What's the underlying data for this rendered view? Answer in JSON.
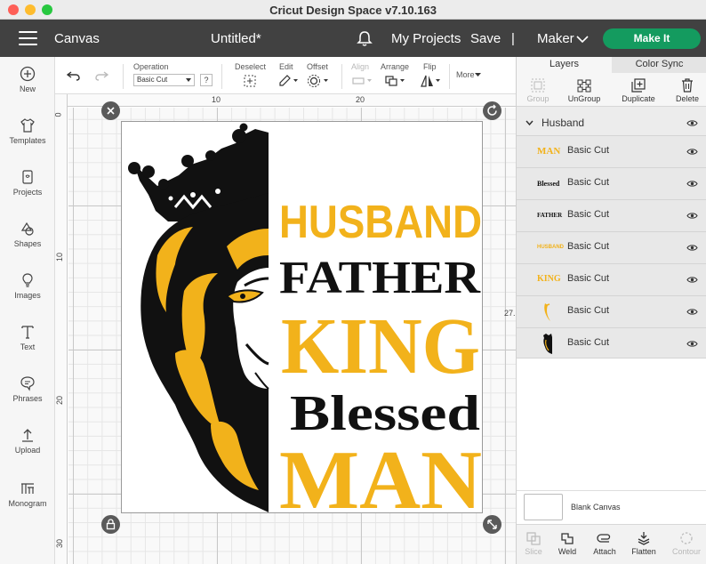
{
  "window": {
    "title": "Cricut Design Space  v7.10.163"
  },
  "header": {
    "section": "Canvas",
    "doc_title": "Untitled*",
    "my_projects": "My Projects",
    "save": "Save",
    "separator": "|",
    "machine": "Maker",
    "make_it": "Make It"
  },
  "leftnav": [
    {
      "label": "New",
      "icon": "plus-circle-icon"
    },
    {
      "label": "Templates",
      "icon": "tshirt-icon"
    },
    {
      "label": "Projects",
      "icon": "projects-icon"
    },
    {
      "label": "Shapes",
      "icon": "shapes-icon"
    },
    {
      "label": "Images",
      "icon": "lightbulb-icon"
    },
    {
      "label": "Text",
      "icon": "text-icon"
    },
    {
      "label": "Phrases",
      "icon": "speech-bubble-icon"
    },
    {
      "label": "Upload",
      "icon": "upload-icon"
    },
    {
      "label": "Monogram",
      "icon": "monogram-icon"
    }
  ],
  "toolbar": {
    "operation_label": "Operation",
    "operation_value": "Basic Cut",
    "help": "?",
    "deselect": "Deselect",
    "edit": "Edit",
    "offset": "Offset",
    "align": "Align",
    "arrange": "Arrange",
    "flip": "Flip",
    "more": "More"
  },
  "rulers": {
    "top": [
      "0",
      "10",
      "20"
    ],
    "left": [
      "0",
      "10",
      "20",
      "30"
    ],
    "height_readout": "27."
  },
  "design": {
    "words": [
      "HUSBAND",
      "FATHER",
      "KING",
      "Blessed",
      "MAN"
    ],
    "colors": {
      "gold": "#f2b21b",
      "black": "#111111"
    }
  },
  "panel": {
    "tabs": [
      "Layers",
      "Color Sync"
    ],
    "actions": [
      {
        "label": "Group",
        "enabled": false
      },
      {
        "label": "UnGroup",
        "enabled": true
      },
      {
        "label": "Duplicate",
        "enabled": true
      },
      {
        "label": "Delete",
        "enabled": true
      }
    ],
    "group_name": "Husband",
    "layers": [
      {
        "thumb": "MAN",
        "name": "Basic Cut"
      },
      {
        "thumb": "Blessed",
        "name": "Basic Cut"
      },
      {
        "thumb": "FATHER",
        "name": "Basic Cut"
      },
      {
        "thumb": "HUSBAND",
        "name": "Basic Cut"
      },
      {
        "thumb": "KING",
        "name": "Basic Cut"
      },
      {
        "thumb": "",
        "name": "Basic Cut"
      },
      {
        "thumb": "",
        "name": "Basic Cut"
      }
    ],
    "blank_canvas": "Blank Canvas",
    "bottom": [
      {
        "label": "Slice",
        "enabled": false
      },
      {
        "label": "Weld",
        "enabled": true
      },
      {
        "label": "Attach",
        "enabled": true
      },
      {
        "label": "Flatten",
        "enabled": true
      },
      {
        "label": "Contour",
        "enabled": false
      }
    ]
  }
}
